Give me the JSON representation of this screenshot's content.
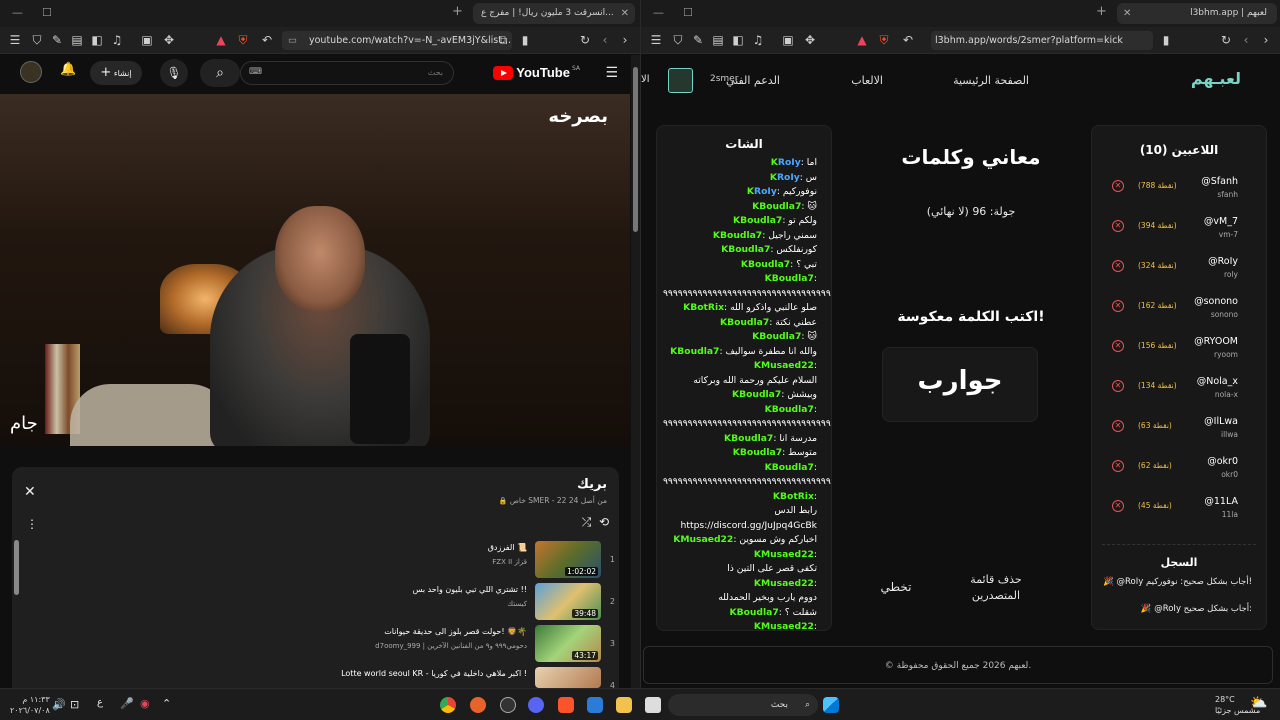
{
  "left_browser": {
    "tab_title": "انسرقت 3 مليون ريال! | مفرج ع...",
    "url": "youtube.com/watch?v=-N_-avEM3jY&list..."
  },
  "youtube": {
    "logo_text": "YouTube",
    "region": "SA",
    "search_placeholder": "بحث",
    "create_label": "إنشاء",
    "video_overlay_logo": "بصرخه",
    "video_watermark": "جام",
    "playlist": {
      "title": "بريك",
      "subtitle": "خاص SMER - 22 من أصل 24",
      "items": [
        {
          "n": "1",
          "title": "الفرزدق 📜",
          "channel": "FZX II قزاز",
          "duration": "1:02:02"
        },
        {
          "n": "2",
          "title": "تشتري اللي تبي بليون واحد بس !!",
          "channel": "كيستك",
          "duration": "39:48"
        },
        {
          "n": "3",
          "title": "حولت قصر بلوز الى حديقة حيوانات! 🦁🌴",
          "channel": "d7oomy_999 | دحومي٩٩٩ و٩ من الفنانين الآخرين",
          "duration": "43:17"
        },
        {
          "n": "4",
          "title": "Lotte world seoul KR - اكبر ملاهي داخلية في كوريا !",
          "channel": "",
          "duration": ""
        }
      ]
    }
  },
  "right_browser": {
    "tab_title": "l3bhm.app | لعبهم",
    "url": "l3bhm.app/words/2smer?platform=kick"
  },
  "site": {
    "logo": "لعبـهم",
    "nav": {
      "home": "الصفحة الرئيسية",
      "games": "الالعاب",
      "support": "الدعم الفني",
      "user": "2smer",
      "extra": "الا"
    },
    "players_title": "اللاعبين (10)",
    "players": [
      {
        "name": "@Sfanh",
        "user": "sfanh",
        "points": "(788 نقطة)"
      },
      {
        "name": "@vM_7",
        "user": "vm-7",
        "points": "(394 نقطة)"
      },
      {
        "name": "@RoIy",
        "user": "roly",
        "points": "(324 نقطة)"
      },
      {
        "name": "@sonono",
        "user": "sonono",
        "points": "(162 نقطة)"
      },
      {
        "name": "@RYOOM",
        "user": "ryoom",
        "points": "(156 نقطة)"
      },
      {
        "name": "@Nola_x",
        "user": "nola-x",
        "points": "(134 نقطة)"
      },
      {
        "name": "@IlLwa",
        "user": "illwa",
        "points": "(63 نقطة)"
      },
      {
        "name": "@okr0",
        "user": "okr0",
        "points": "(62 نقطة)"
      },
      {
        "name": "@11LA",
        "user": "11la",
        "points": "(45 نقطة)"
      }
    ],
    "log_title": "السجل",
    "log": [
      "🎉 @RoIy أجاب بشكل صحيح: نوفوركيم!",
      "🎉 @RoIy أجاب بشكل صحيح:"
    ],
    "game_title": "معاني وكلمات",
    "round": "جولة: 96 (لا نهائي)",
    "prompt": "اكتب الكلمة معكوسة!",
    "word": "جوارب",
    "clear_board": "حذف قائمة المتصدرين",
    "skip": "تخطي",
    "chat_title": "الشات",
    "chat": [
      {
        "u": "RoIy",
        "m": "اما",
        "c": "#4aa8ff"
      },
      {
        "u": "RoIy",
        "m": "س",
        "c": "#4aa8ff"
      },
      {
        "u": "RoIy",
        "m": "نوفوركيم",
        "c": "#4aa8ff"
      },
      {
        "u": "Boudla7",
        "m": "🐱",
        "c": "#53fc18"
      },
      {
        "u": "Boudla7",
        "m": "ولكم تو",
        "c": "#53fc18"
      },
      {
        "u": "Boudla7",
        "m": "سمني راجيل",
        "c": "#53fc18"
      },
      {
        "u": "Boudla7",
        "m": "كورنفلكس",
        "c": "#53fc18"
      },
      {
        "u": "Boudla7",
        "m": "تبي ؟",
        "c": "#53fc18"
      },
      {
        "u": "Boudla7",
        "m": "",
        "c": "#53fc18"
      },
      {
        "u": "",
        "m": "٩٩٩٩٩٩٩٩٩٩٩٩٩٩٩٩٩٩٩٩٩٩٩٩٩٩٩٩٩٩٩٩٩٩٩",
        "c": "#fff"
      },
      {
        "u": "BotRix",
        "m": "صلو عالنبي واذكرو الله",
        "c": "#53fc18"
      },
      {
        "u": "Boudla7",
        "m": "عطني نكتة",
        "c": "#53fc18"
      },
      {
        "u": "Boudla7",
        "m": "🐱",
        "c": "#53fc18"
      },
      {
        "u": "Boudla7",
        "m": "والله انا مطفرة سواليف",
        "c": "#53fc18"
      },
      {
        "u": "Musaed22",
        "m": "",
        "c": "#53fc18"
      },
      {
        "u": "",
        "m": "السلام عليكم ورحمة الله وبركاته",
        "c": "#fff"
      },
      {
        "u": "Boudla7",
        "m": "وبيشش",
        "c": "#53fc18"
      },
      {
        "u": "Boudla7",
        "m": "",
        "c": "#53fc18"
      },
      {
        "u": "",
        "m": "٩٩٩٩٩٩٩٩٩٩٩٩٩٩٩٩٩٩٩٩٩٩٩٩٩٩٩٩٩٩٩٩٩٩٩",
        "c": "#fff"
      },
      {
        "u": "Boudla7",
        "m": "مدرسة انا",
        "c": "#53fc18"
      },
      {
        "u": "Boudla7",
        "m": "متوسط",
        "c": "#53fc18"
      },
      {
        "u": "Boudla7",
        "m": "",
        "c": "#53fc18"
      },
      {
        "u": "",
        "m": "٩٩٩٩٩٩٩٩٩٩٩٩٩٩٩٩٩٩٩٩٩٩٩٩٩٩٩٩٩٩٩٩٩٩٩",
        "c": "#fff"
      },
      {
        "u": "BotRix",
        "m": "",
        "c": "#53fc18"
      },
      {
        "u": "",
        "m": "رابط الدس",
        "c": "#fff"
      },
      {
        "u": "",
        "m": "https://discord.gg/JuJpq4GcBk",
        "c": "#fff"
      },
      {
        "u": "Musaed22",
        "m": "اخباركم وش مسوين",
        "c": "#53fc18"
      },
      {
        "u": "Musaed22",
        "m": "",
        "c": "#53fc18"
      },
      {
        "u": "",
        "m": "تكفى قصر على التين ذا",
        "c": "#fff"
      },
      {
        "u": "Musaed22",
        "m": "",
        "c": "#53fc18"
      },
      {
        "u": "",
        "m": "دووم يارب وبخير الحمدلله",
        "c": "#fff"
      },
      {
        "u": "Boudla7",
        "m": "شقلت ؟",
        "c": "#53fc18"
      },
      {
        "u": "Musaed22",
        "m": "",
        "c": "#53fc18"
      }
    ],
    "footer": "© لعبهم 2026 جميع الحقوق محفوظة."
  },
  "taskbar": {
    "search": "بحث",
    "time": "١١:٣٣ م",
    "date": "٢٠٢٦/٠٧/٠٨",
    "lang": "ع",
    "temp": "28°C",
    "weather": "مشمس جزئيًا"
  }
}
